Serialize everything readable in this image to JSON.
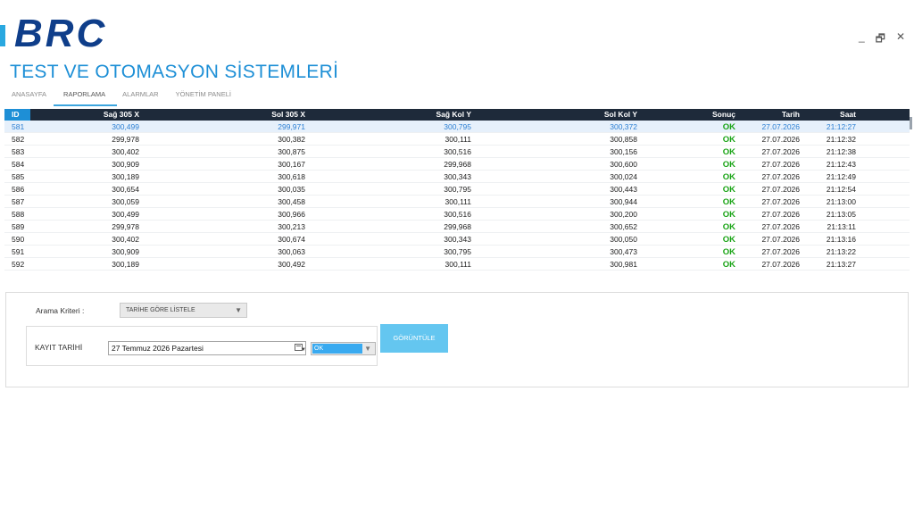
{
  "brand": {
    "logo_text": "BRC",
    "accent_color": "#29a8e0",
    "logo_color": "#0f3e8a"
  },
  "window_controls": [
    {
      "name": "minimize-icon",
      "glyph": "_"
    },
    {
      "name": "restore-icon",
      "glyph": "🗗"
    },
    {
      "name": "close-icon",
      "glyph": "✕"
    }
  ],
  "app_title": "TEST VE OTOMASYON SİSTEMLERİ",
  "tabs": [
    {
      "label": "ANASAYFA",
      "active": false
    },
    {
      "label": "RAPORLAMA",
      "active": true
    },
    {
      "label": "ALARMLAR",
      "active": false
    },
    {
      "label": "YÖNETİM PANELİ",
      "active": false
    }
  ],
  "table": {
    "columns": [
      "ID",
      "Sağ 305 X",
      "Sol 305 X",
      "Sağ Kol Y",
      "Sol Kol Y",
      "Sonuç",
      "Tarih",
      "Saat"
    ],
    "selected_row": 0,
    "rows": [
      [
        "581",
        "300,499",
        "299,971",
        "300,795",
        "300,372",
        "OK",
        "27.07.2026",
        "21:12:27"
      ],
      [
        "582",
        "299,978",
        "300,382",
        "300,111",
        "300,858",
        "OK",
        "27.07.2026",
        "21:12:32"
      ],
      [
        "583",
        "300,402",
        "300,875",
        "300,516",
        "300,156",
        "OK",
        "27.07.2026",
        "21:12:38"
      ],
      [
        "584",
        "300,909",
        "300,167",
        "299,968",
        "300,600",
        "OK",
        "27.07.2026",
        "21:12:43"
      ],
      [
        "585",
        "300,189",
        "300,618",
        "300,343",
        "300,024",
        "OK",
        "27.07.2026",
        "21:12:49"
      ],
      [
        "586",
        "300,654",
        "300,035",
        "300,795",
        "300,443",
        "OK",
        "27.07.2026",
        "21:12:54"
      ],
      [
        "587",
        "300,059",
        "300,458",
        "300,111",
        "300,944",
        "OK",
        "27.07.2026",
        "21:13:00"
      ],
      [
        "588",
        "300,499",
        "300,966",
        "300,516",
        "300,200",
        "OK",
        "27.07.2026",
        "21:13:05"
      ],
      [
        "589",
        "299,978",
        "300,213",
        "299,968",
        "300,652",
        "OK",
        "27.07.2026",
        "21:13:11"
      ],
      [
        "590",
        "300,402",
        "300,674",
        "300,343",
        "300,050",
        "OK",
        "27.07.2026",
        "21:13:16"
      ],
      [
        "591",
        "300,909",
        "300,063",
        "300,795",
        "300,473",
        "OK",
        "27.07.2026",
        "21:13:22"
      ],
      [
        "592",
        "300,189",
        "300,492",
        "300,111",
        "300,981",
        "OK",
        "27.07.2026",
        "21:13:27"
      ]
    ]
  },
  "search": {
    "criteria_label": "Arama Kriteri :",
    "criteria_value": "TARİHE GÖRE LİSTELE",
    "date_label": "KAYIT TARİHİ",
    "date_value": "27 Temmuz 2026  Pazartesi",
    "result_filter_value": "OK",
    "view_button_label": "GÖRÜNTÜLE"
  }
}
